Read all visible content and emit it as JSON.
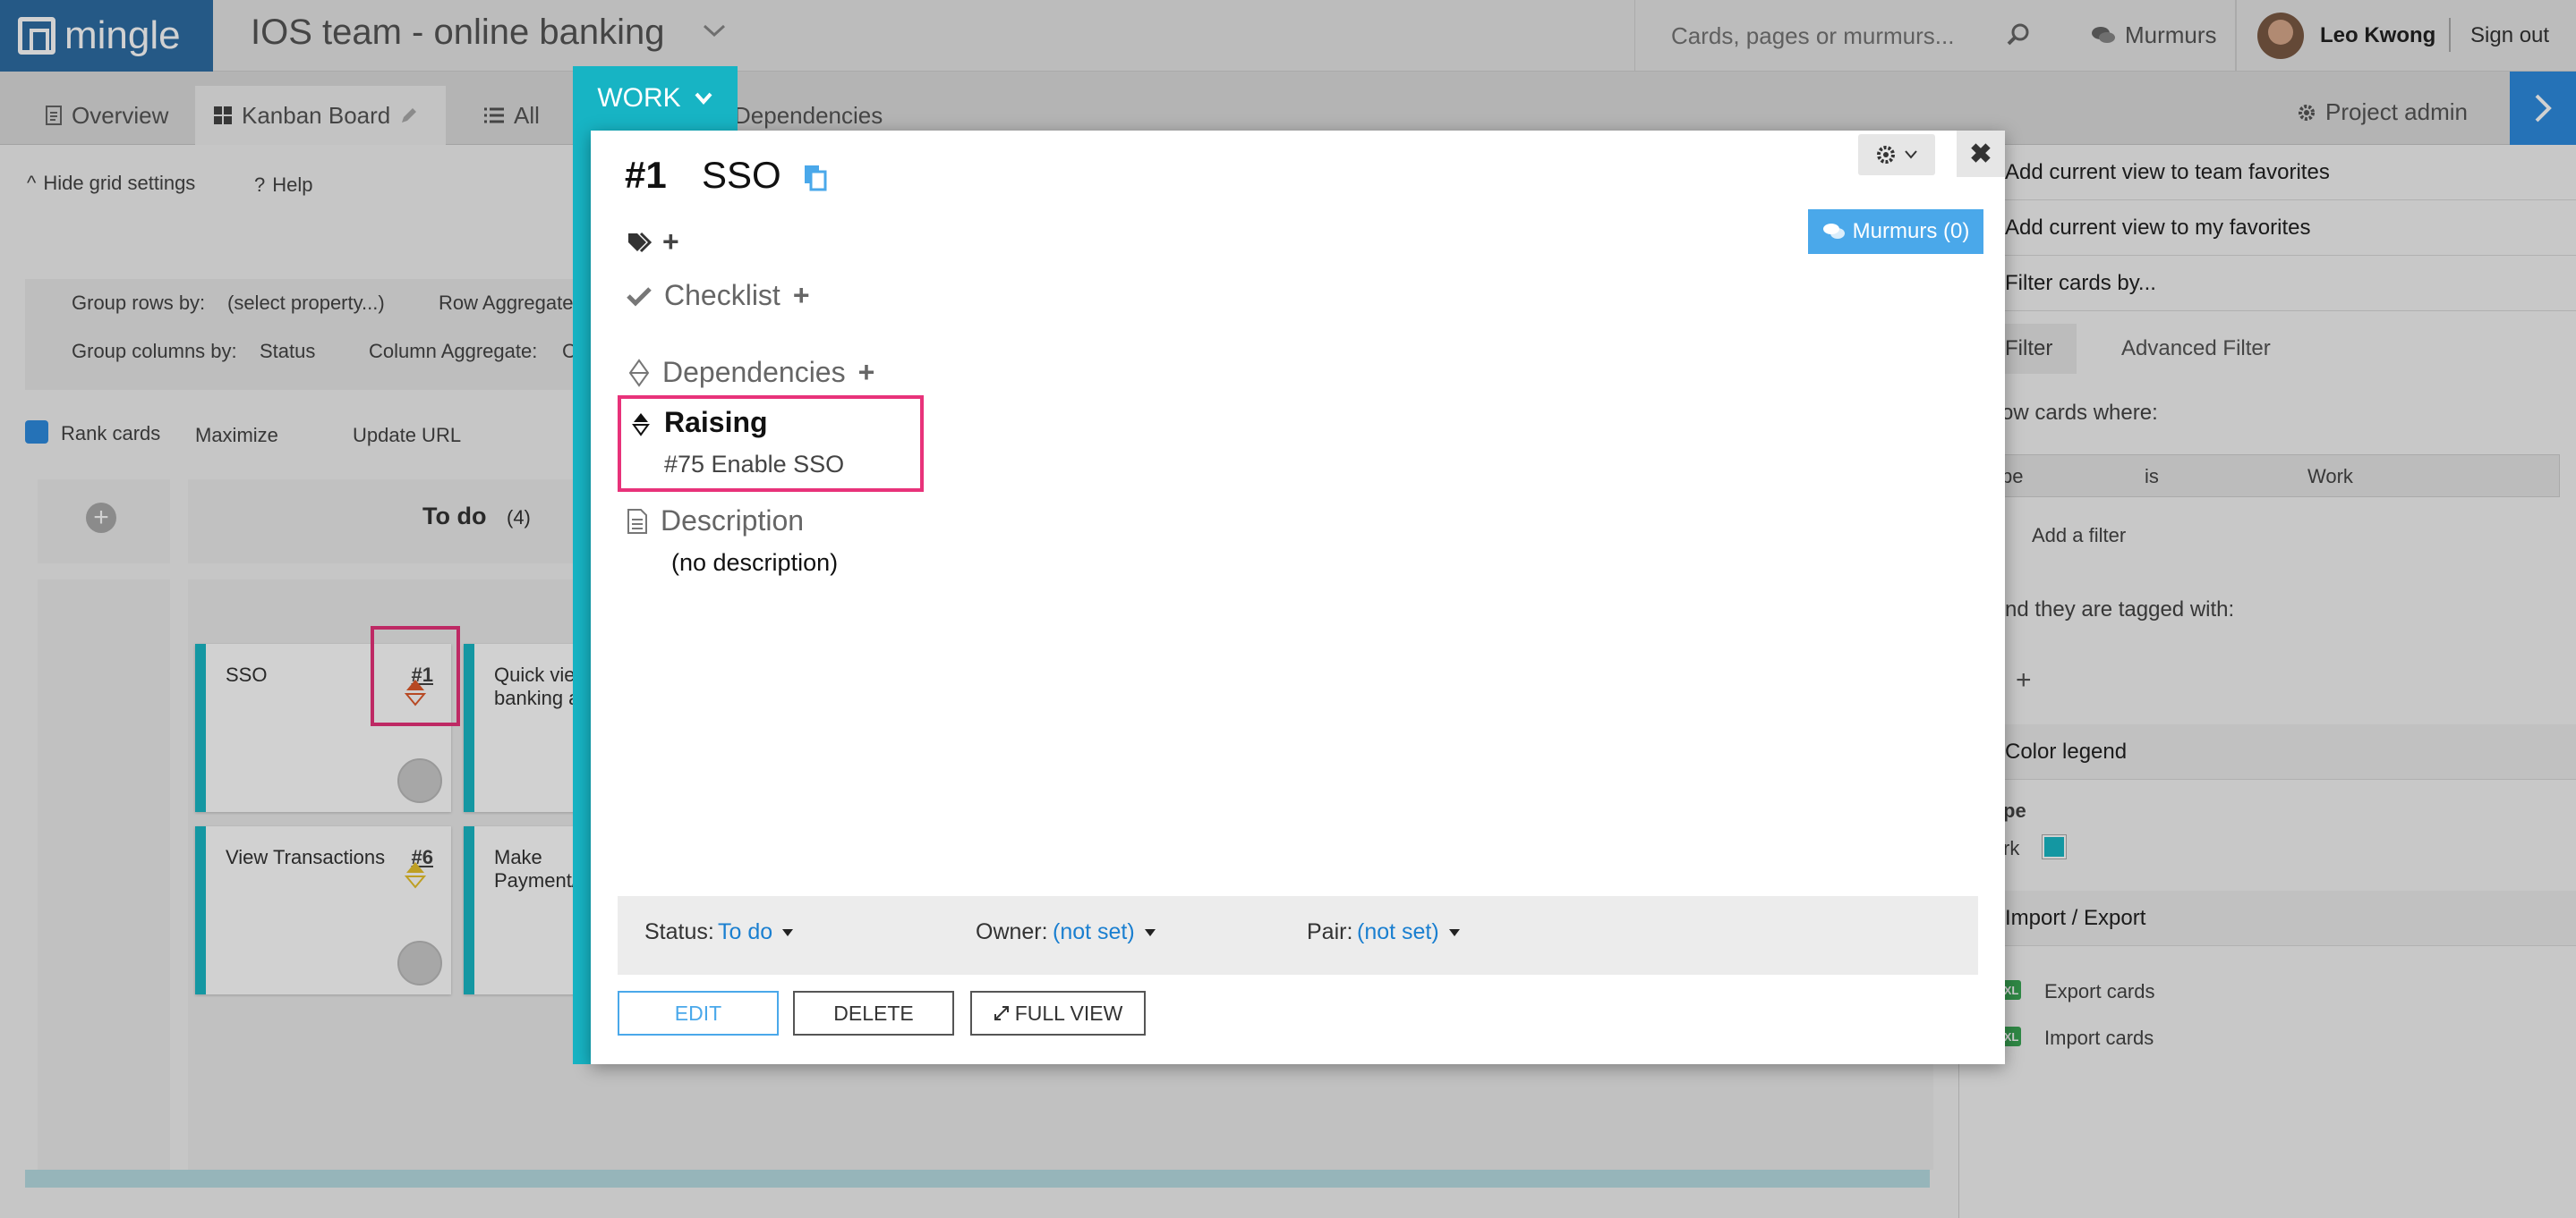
{
  "app": {
    "logo_text": "mingle",
    "project_title": "IOS team - online banking"
  },
  "header": {
    "search_placeholder": "Cards, pages or murmurs...",
    "murmurs_label": "Murmurs",
    "user_name": "Leo Kwong",
    "sign_out": "Sign out"
  },
  "tabs": {
    "overview": "Overview",
    "kanban": "Kanban Board",
    "all": "All",
    "dependencies": "Dependencies",
    "project_admin": "Project admin"
  },
  "grid": {
    "hide_settings": "Hide grid settings",
    "help": "Help",
    "group_rows_label": "Group rows by:",
    "group_rows_value": "(select property...)",
    "row_aggregate": "Row Aggregate",
    "group_cols_label": "Group columns by:",
    "group_cols_value": "Status",
    "col_aggregate": "Column Aggregate:",
    "col_aggregate_value": "C",
    "rank_cards": "Rank cards",
    "maximize": "Maximize",
    "update_url": "Update URL",
    "column_todo": "To do",
    "column_todo_count": "(4)"
  },
  "cards": [
    {
      "title": "SSO",
      "number": "#1"
    },
    {
      "title": "Quick view banking a",
      "number": ""
    },
    {
      "title": "View Transactions",
      "number": "#6"
    },
    {
      "title": "Make Payment/",
      "number": ""
    }
  ],
  "right_panel": {
    "team_fav": "Add current view to team favorites",
    "my_fav": "Add current view to my favorites",
    "filter_by": "Filter cards by...",
    "filter_tab": "Filter",
    "adv_filter_tab": "Advanced Filter",
    "show_cards_where": "ow cards where:",
    "filter_prop": "pe",
    "filter_op": "is",
    "filter_val": "Work",
    "add_filter": "Add a filter",
    "tagged_with": "nd they are tagged with:",
    "color_legend": "Color legend",
    "legend_type": "pe",
    "legend_item": "rk",
    "import_export": "Import / Export",
    "export_cards": "Export cards",
    "import_cards": "Import cards"
  },
  "modal": {
    "card_type": "WORK",
    "card_number": "#1",
    "card_title": "SSO",
    "murmurs_button": "Murmurs (0)",
    "checklist": "Checklist",
    "dependencies": "Dependencies",
    "raising_label": "Raising",
    "raising_dep": "#75 Enable SSO",
    "description": "Description",
    "no_description": "(no description)",
    "status_label": "Status:",
    "status_value": "To do",
    "owner_label": "Owner:",
    "owner_value": "(not set)",
    "pair_label": "Pair:",
    "pair_value": "(not set)",
    "edit": "EDIT",
    "delete": "DELETE",
    "full_view": "FULL VIEW"
  },
  "colors": {
    "accent": "#17b4c4",
    "brand": "#2e6da4",
    "highlight": "#e8327a",
    "link": "#1a7fd0"
  }
}
